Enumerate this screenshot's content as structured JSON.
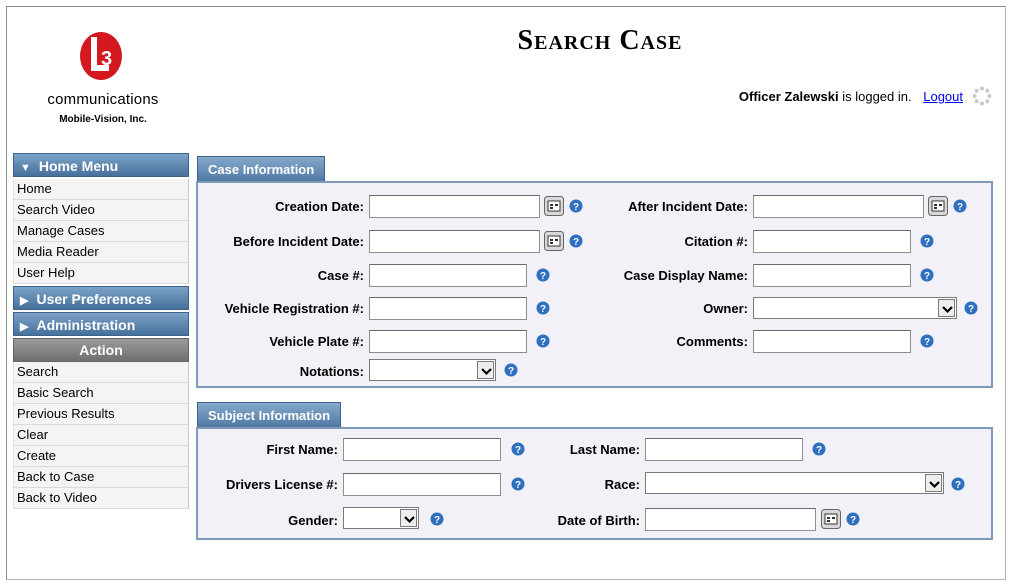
{
  "brand": {
    "name": "communications",
    "subtitle": "Mobile-Vision, Inc.",
    "mark": "L3"
  },
  "page_title": "Search Case",
  "login": {
    "user": "Officer Zalewski",
    "suffix": "is logged in.",
    "logout": "Logout"
  },
  "sidebar": {
    "home_menu": "Home Menu",
    "home_items": [
      "Home",
      "Search Video",
      "Manage Cases",
      "Media Reader",
      "User Help"
    ],
    "user_preferences": "User Preferences",
    "administration": "Administration",
    "action_header": "Action",
    "action_items": [
      "Search",
      "Basic Search",
      "Previous Results",
      "Clear",
      "Create",
      "Back to Case",
      "Back to Video"
    ]
  },
  "case_info": {
    "tab": "Case Information",
    "creation_date": {
      "label": "Creation Date:",
      "value": ""
    },
    "after_incident_date": {
      "label": "After Incident Date:",
      "value": ""
    },
    "before_incident_date": {
      "label": "Before Incident Date:",
      "value": ""
    },
    "citation": {
      "label": "Citation #:",
      "value": ""
    },
    "case_number": {
      "label": "Case #:",
      "value": ""
    },
    "case_display_name": {
      "label": "Case Display Name:",
      "value": ""
    },
    "vehicle_registration": {
      "label": "Vehicle Registration #:",
      "value": ""
    },
    "owner": {
      "label": "Owner:",
      "value": ""
    },
    "vehicle_plate": {
      "label": "Vehicle Plate #:",
      "value": ""
    },
    "comments": {
      "label": "Comments:",
      "value": ""
    },
    "notations": {
      "label": "Notations:",
      "value": ""
    }
  },
  "subject_info": {
    "tab": "Subject Information",
    "first_name": {
      "label": "First Name:",
      "value": ""
    },
    "last_name": {
      "label": "Last Name:",
      "value": ""
    },
    "drivers_license": {
      "label": "Drivers License #:",
      "value": ""
    },
    "race": {
      "label": "Race:",
      "value": ""
    },
    "gender": {
      "label": "Gender:",
      "value": ""
    },
    "date_of_birth": {
      "label": "Date of Birth:",
      "value": ""
    }
  },
  "colors": {
    "menu_blue": "#46719b",
    "panel_border": "#7f9ab8",
    "panel_bg": "#f1f1f7",
    "help_blue": "#2f6fc0"
  }
}
